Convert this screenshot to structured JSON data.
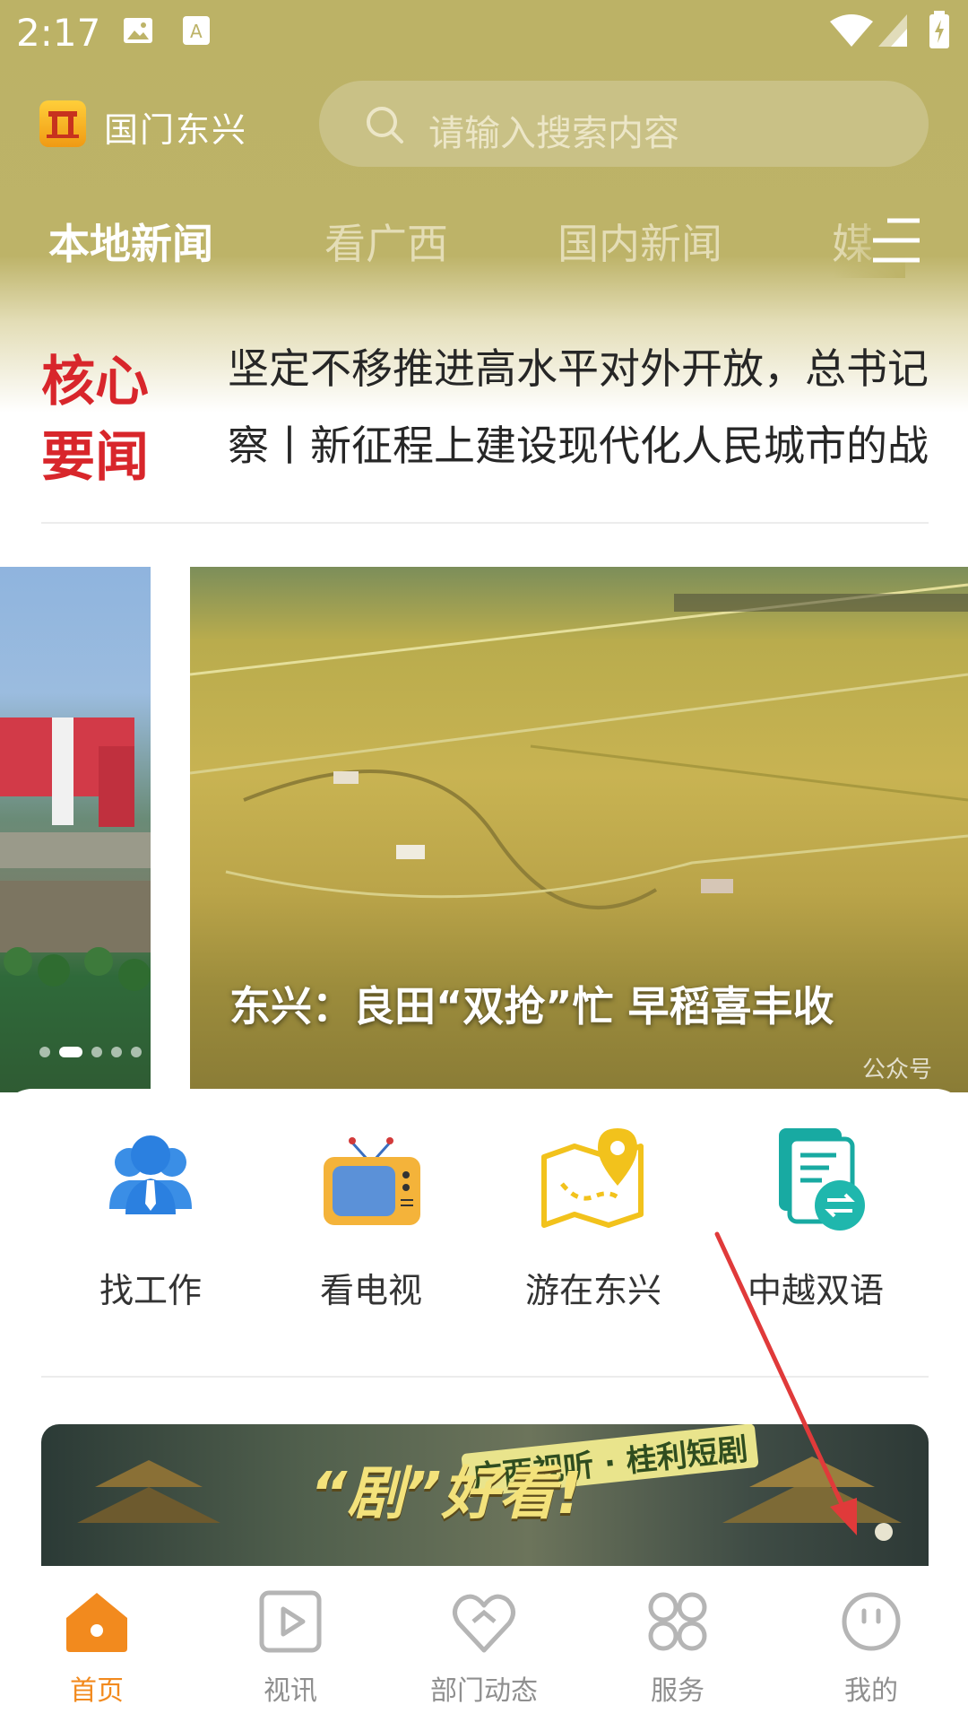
{
  "status_bar": {
    "time": "2:17"
  },
  "app": {
    "name": "国门东兴"
  },
  "search": {
    "placeholder": "请输入搜索内容"
  },
  "tabs": [
    {
      "label": "本地新闻",
      "active": true
    },
    {
      "label": "看广西",
      "active": false
    },
    {
      "label": "国内新闻",
      "active": false
    },
    {
      "label": "媒",
      "active": false
    }
  ],
  "core_news": {
    "badge": "核心要闻",
    "headlines": [
      "坚定不移推进高水平对外开放，总书记",
      "察丨新征程上建设现代化人民城市的战"
    ]
  },
  "carousel": {
    "caption": "东兴：良田“双抢”忙 早稻喜丰收",
    "watermark": "公众号",
    "current_index": 2,
    "total": 5
  },
  "services": [
    {
      "label": "找工作",
      "icon": "people-icon"
    },
    {
      "label": "看电视",
      "icon": "tv-icon"
    },
    {
      "label": "游在东兴",
      "icon": "map-pin-icon"
    },
    {
      "label": "中越双语",
      "icon": "bilingual-docs-icon"
    }
  ],
  "banner": {
    "title": "“剧”好看!",
    "subtitle": "广西视听 · 桂利短剧"
  },
  "bottom_nav": [
    {
      "label": "首页",
      "icon": "home-icon",
      "active": true
    },
    {
      "label": "视讯",
      "icon": "play-icon",
      "active": false
    },
    {
      "label": "部门动态",
      "icon": "heart-icon",
      "active": false
    },
    {
      "label": "服务",
      "icon": "grid-icon",
      "active": false
    },
    {
      "label": "我的",
      "icon": "smiley-icon",
      "active": false
    }
  ],
  "colors": {
    "header": "#bdb368",
    "accent": "#f28a1e",
    "badge_red": "#d8262b",
    "annotation_arrow": "#e03a3a"
  }
}
